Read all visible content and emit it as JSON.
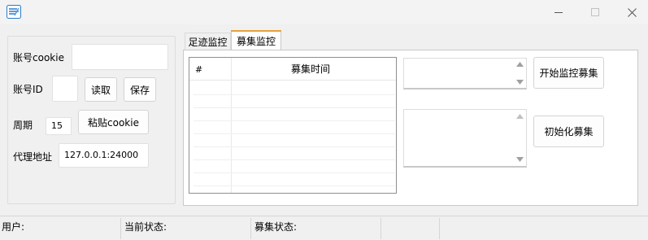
{
  "window": {
    "title": "",
    "icon": "app-logo-icon",
    "controls": [
      "minimize-icon",
      "maximize-icon",
      "close-icon"
    ]
  },
  "left_panel": {
    "cookie_label": "账号cookie",
    "cookie_value": "",
    "id_label": "账号ID",
    "id_value": "",
    "read_button": "读取",
    "save_button": "保存",
    "period_label": "周期",
    "period_value": "15",
    "paste_cookie_button": "粘贴cookie",
    "proxy_label": "代理地址",
    "proxy_value": "127.0.0.1:24000"
  },
  "tabs": [
    {
      "label": "足迹监控",
      "selected": false
    },
    {
      "label": "募集监控",
      "selected": true
    }
  ],
  "recruit_tab": {
    "list": {
      "columns": [
        "#",
        "募集时间"
      ],
      "rows": []
    },
    "start_button": "开始监控募集",
    "init_button": "初始化募集",
    "top_box_value": "",
    "bottom_box_value": ""
  },
  "status_bar": {
    "user_label": "用户:",
    "current_state_label": "当前状态:",
    "recruit_state_label": "募集状态:"
  },
  "colors": {
    "background": "#f0f0f0",
    "selected_tab_accent": "#e6a23c",
    "list_border": "#8f8f8f"
  }
}
